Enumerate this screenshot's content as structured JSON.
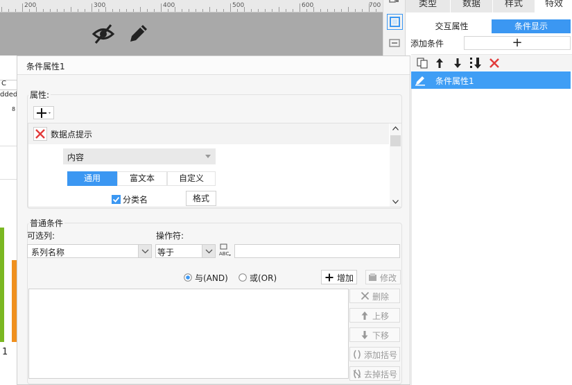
{
  "ruler": {
    "labels": [
      "200",
      "300",
      "400",
      "500",
      "600",
      "700"
    ]
  },
  "preview": {
    "col_label": "C",
    "cell_text": "dded",
    "cell_num": "8",
    "bottom_num": "1"
  },
  "side_toolbar": {
    "icons": [
      "frame-icon",
      "select-icon",
      "widget-icon"
    ]
  },
  "right_panel": {
    "tabs": [
      "类型",
      "数据",
      "样式",
      "特效"
    ],
    "active_tab": "特效",
    "subtabs": [
      "交互属性",
      "条件显示"
    ],
    "active_subtab": "条件显示",
    "add_condition_label": "添加条件",
    "add_symbol": "+",
    "list_items": [
      "条件属性1"
    ]
  },
  "dialog": {
    "title": "条件属性1",
    "properties_label": "属性:",
    "item_label": "数据点提示",
    "content_select": "内容",
    "style_tabs": [
      "通用",
      "富文本",
      "自定义"
    ],
    "active_style_tab": "通用",
    "checkbox_label": "分类名",
    "checkbox_checked": true,
    "format_button": "格式",
    "conditions_label": "普通条件",
    "column_label": "可选列:",
    "column_value": "系列名称",
    "operator_label": "操作符:",
    "operator_value": "等于",
    "value_field": "",
    "and_label": "与(AND)",
    "or_label": "或(OR)",
    "selected_logic": "and",
    "add_button": "增加",
    "modify_button": "修改",
    "delete_button": "删除",
    "up_button": "上移",
    "down_button": "下移",
    "add_bracket_button": "添加括号",
    "remove_bracket_button": "去掉括号"
  },
  "colors": {
    "accent": "#3b97f2",
    "selected_row": "#3f9ef5",
    "gray_canvas": "#a9a9a9",
    "chart_green": "#7bb822",
    "chart_orange": "#f0901e"
  }
}
